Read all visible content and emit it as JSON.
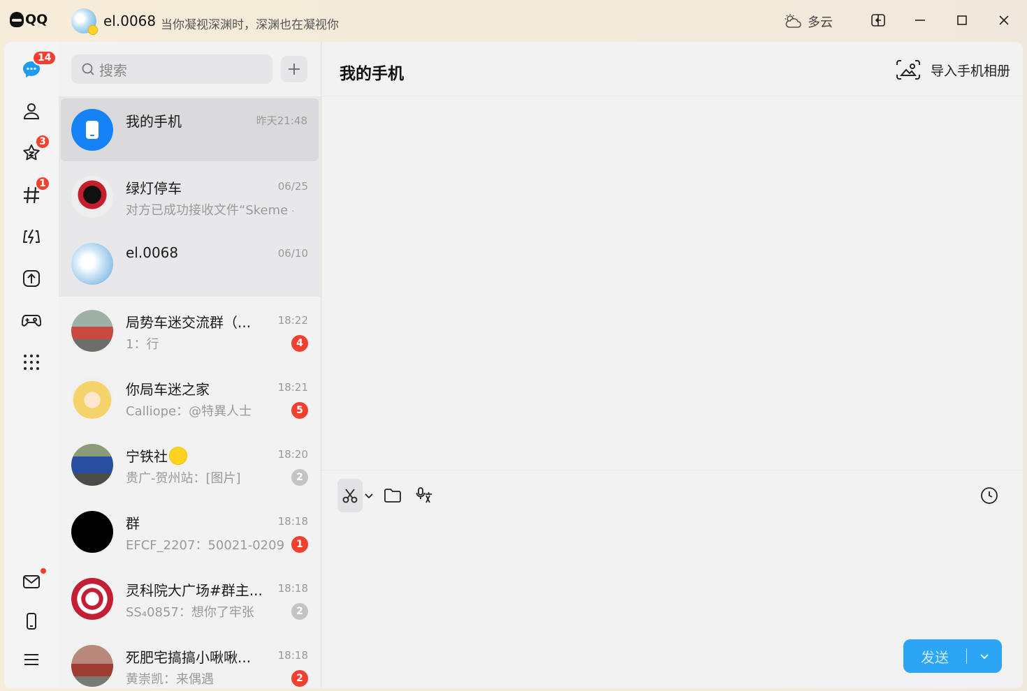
{
  "app": {
    "logo_text": "QQ"
  },
  "profile": {
    "name": "el.0068",
    "signature": "当你凝视深渊时，深渊也在凝视你"
  },
  "weather": {
    "text": "多云"
  },
  "rail": {
    "messages_badge": "14",
    "favorites_badge": "3",
    "moments_badge": "1"
  },
  "search": {
    "placeholder": "搜索"
  },
  "conversations": [
    {
      "name": "我的手机",
      "time": "昨天21:48",
      "preview": "",
      "unread": ""
    },
    {
      "name": "绿灯停车",
      "time": "06/25",
      "preview": "对方已成功接收文件“Skeme - ...",
      "unread": ""
    },
    {
      "name": "el.0068",
      "time": "06/10",
      "preview": "",
      "unread": ""
    },
    {
      "name": "局势车迷交流群（...",
      "time": "18:22",
      "preview": "1：行",
      "unread": "4"
    },
    {
      "name": "你局车迷之家",
      "time": "18:21",
      "preview": "Calliope：@特異人士",
      "unread": "5"
    },
    {
      "name": "宁铁社",
      "time": "18:20",
      "preview": "贵广-贺州站：[图片]",
      "unread": "2"
    },
    {
      "name": "群",
      "time": "18:18",
      "preview": "EFCF_2207：50021-0209 ...",
      "unread": "1"
    },
    {
      "name": "灵科院大广场#群主...",
      "time": "18:18",
      "preview": "SS₄0857：想你了牢张",
      "unread": "2"
    },
    {
      "name": "死肥宅搞搞小啾啾...",
      "time": "18:18",
      "preview": "黄崇凯：来偶遇",
      "unread": "2"
    }
  ],
  "chat": {
    "title": "我的手机",
    "import_label": "导入手机相册",
    "send_label": "发送"
  },
  "colors": {
    "accent": "#2aa6f4",
    "badge_red": "#f1402f",
    "badge_gray": "#c4c4c4",
    "selected_bg": "#dadadc"
  }
}
